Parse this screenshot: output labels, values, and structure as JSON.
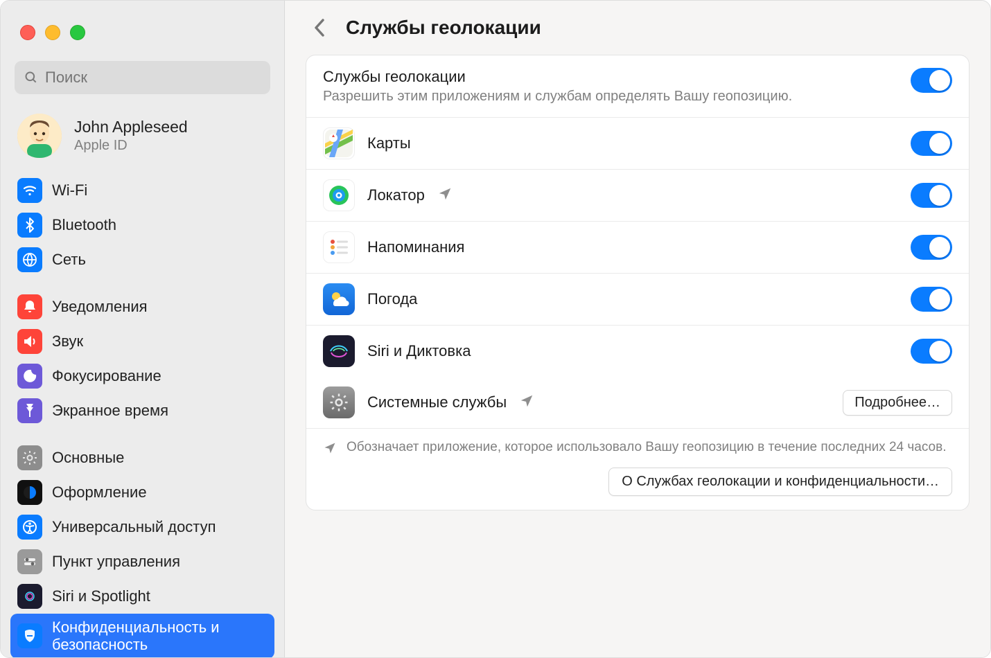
{
  "search": {
    "placeholder": "Поиск"
  },
  "account": {
    "name": "John Appleseed",
    "sub": "Apple ID"
  },
  "sidebar": {
    "groups": [
      {
        "items": [
          {
            "id": "wifi",
            "label": "Wi-Fi"
          },
          {
            "id": "bluetooth",
            "label": "Bluetooth"
          },
          {
            "id": "network",
            "label": "Сеть"
          }
        ]
      },
      {
        "items": [
          {
            "id": "notifications",
            "label": "Уведомления"
          },
          {
            "id": "sound",
            "label": "Звук"
          },
          {
            "id": "focus",
            "label": "Фокусирование"
          },
          {
            "id": "screentime",
            "label": "Экранное время"
          }
        ]
      },
      {
        "items": [
          {
            "id": "general",
            "label": "Основные"
          },
          {
            "id": "appearance",
            "label": "Оформление"
          },
          {
            "id": "accessibility",
            "label": "Универсальный доступ"
          },
          {
            "id": "controlcenter",
            "label": "Пункт управления"
          },
          {
            "id": "siri",
            "label": "Siri и Spotlight"
          },
          {
            "id": "privacy",
            "label": "Конфиденциальность и безопасность",
            "selected": true
          }
        ]
      }
    ]
  },
  "header": {
    "title": "Службы геолокации"
  },
  "panel": {
    "title": "Службы геолокации",
    "subtitle": "Разрешить этим приложениям и службам определять Вашу геопозицию.",
    "master_toggle": true,
    "apps": [
      {
        "id": "maps",
        "label": "Карты",
        "toggle": true,
        "indicator": false
      },
      {
        "id": "findmy",
        "label": "Локатор",
        "toggle": true,
        "indicator": true
      },
      {
        "id": "reminders",
        "label": "Напоминания",
        "toggle": true,
        "indicator": false
      },
      {
        "id": "weather",
        "label": "Погода",
        "toggle": true,
        "indicator": false
      },
      {
        "id": "siri",
        "label": "Siri и Диктовка",
        "toggle": true,
        "indicator": false
      }
    ],
    "system_services": {
      "label": "Системные службы",
      "indicator": true,
      "button": "Подробнее…"
    },
    "footnote": "Обозначает приложение, которое использовало Вашу геопозицию в течение последних 24 часов.",
    "about_button": "О Службах геолокации и конфиденциальности…"
  }
}
